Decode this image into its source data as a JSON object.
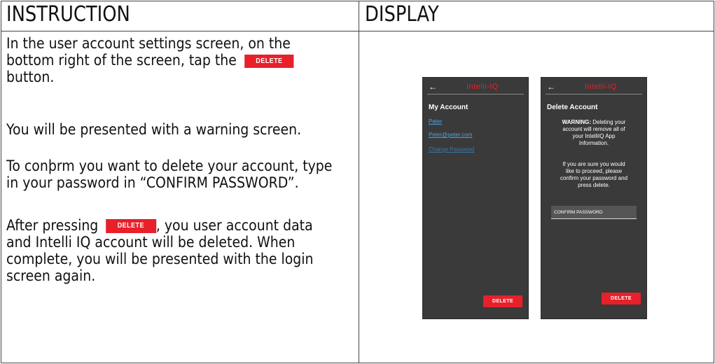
{
  "table": {
    "header_instruction": "INSTRUCTION",
    "header_display": "DISPLAY"
  },
  "instruction": {
    "p1_line1": "In the user account settings screen, on the",
    "p1_line2": "bottom right of the screen, tap the",
    "p1_button": "DELETE",
    "p1_line3": "button.",
    "p2": "You will be presented with a warning screen.",
    "p3_line1": "To conþrm you want to delete your account, type",
    "p3_line2": "in your password in “CONFIRM PASSWORD”.",
    "p4_line1_prefix": "After pressing",
    "p4_button": "DELETE",
    "p4_line1_suffix": ", you user account data",
    "p4_line2": "and Intelli IQ account will be deleted. When",
    "p4_line3": "complete, you will be presented with the login",
    "p4_line4": "screen again."
  },
  "phone_left": {
    "back": "←",
    "brand": "Intelli-IQ",
    "title": "My Account",
    "name": "Peter",
    "email": "Peter@peter.com",
    "change_password": "Change Password",
    "delete_button": "DELETE"
  },
  "phone_right": {
    "back": "←",
    "brand": "Intelli-IQ",
    "title": "Delete Account",
    "warning_bold": "WARNING:",
    "warning_l1": " Deleting your",
    "warning_l2": "account will remove all of",
    "warning_l3": "your IntelliIQ App",
    "warning_l4": "Information.",
    "note_l1": "If you are sure you would",
    "note_l2": "like to proceed, please",
    "note_l3": "confirm your password and",
    "note_l4": "press delete.",
    "confirm_placeholder": "CONFIRM PASSWORD",
    "delete_button": "DELETE"
  },
  "colors": {
    "accent_red": "#e8202a",
    "phone_bg": "#3a3a3a",
    "link_blue": "#4aa3e0"
  }
}
